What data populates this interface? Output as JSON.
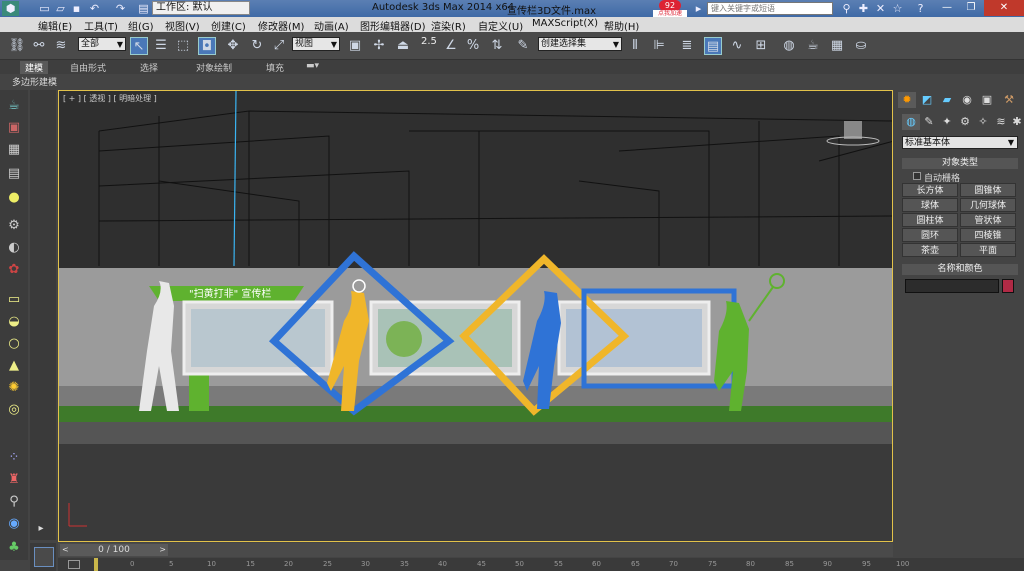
{
  "titlebar": {
    "workspace": "工作区: 默认",
    "app_title": "Autodesk 3ds Max  2014 x64",
    "file_title": "宣传栏3D文件.max",
    "search_placeholder": "键入关键字或短语",
    "badge_count": "92",
    "badge_label": "点我加速"
  },
  "menu": [
    "编辑(E)",
    "工具(T)",
    "组(G)",
    "视图(V)",
    "创建(C)",
    "修改器(M)",
    "动画(A)",
    "图形编辑器(D)",
    "渲染(R)",
    "自定义(U)",
    "MAXScript(X)",
    "帮助(H)"
  ],
  "toolbar": {
    "selection_filter": "全部",
    "ref_coord": "视图",
    "snap_value": "2.5",
    "named_selection": "创建选择集"
  },
  "ribbon": {
    "tabs": [
      "建模",
      "自由形式",
      "选择",
      "对象绘制",
      "填充"
    ],
    "sub_label": "多边形建模"
  },
  "viewport": {
    "label": "[ + ] [ 透视 ] [ 明暗处理 ]",
    "scene_sign": "\"扫黄打非\" 宣传栏"
  },
  "command_panel": {
    "dropdown": "标准基本体",
    "object_type_header": "对象类型",
    "autogrid": "自动栅格",
    "buttons": [
      "长方体",
      "圆锥体",
      "球体",
      "几何球体",
      "圆柱体",
      "管状体",
      "圆环",
      "四棱锥",
      "茶壶",
      "平面"
    ],
    "name_color_header": "名称和颜色",
    "swatch_color": "#b02a45"
  },
  "timeline": {
    "frame": "0 / 100",
    "ticks": [
      "0",
      "5",
      "10",
      "15",
      "20",
      "25",
      "30",
      "35",
      "40",
      "45",
      "50",
      "55",
      "60",
      "65",
      "70",
      "75",
      "80",
      "85",
      "90",
      "95",
      "100"
    ]
  }
}
